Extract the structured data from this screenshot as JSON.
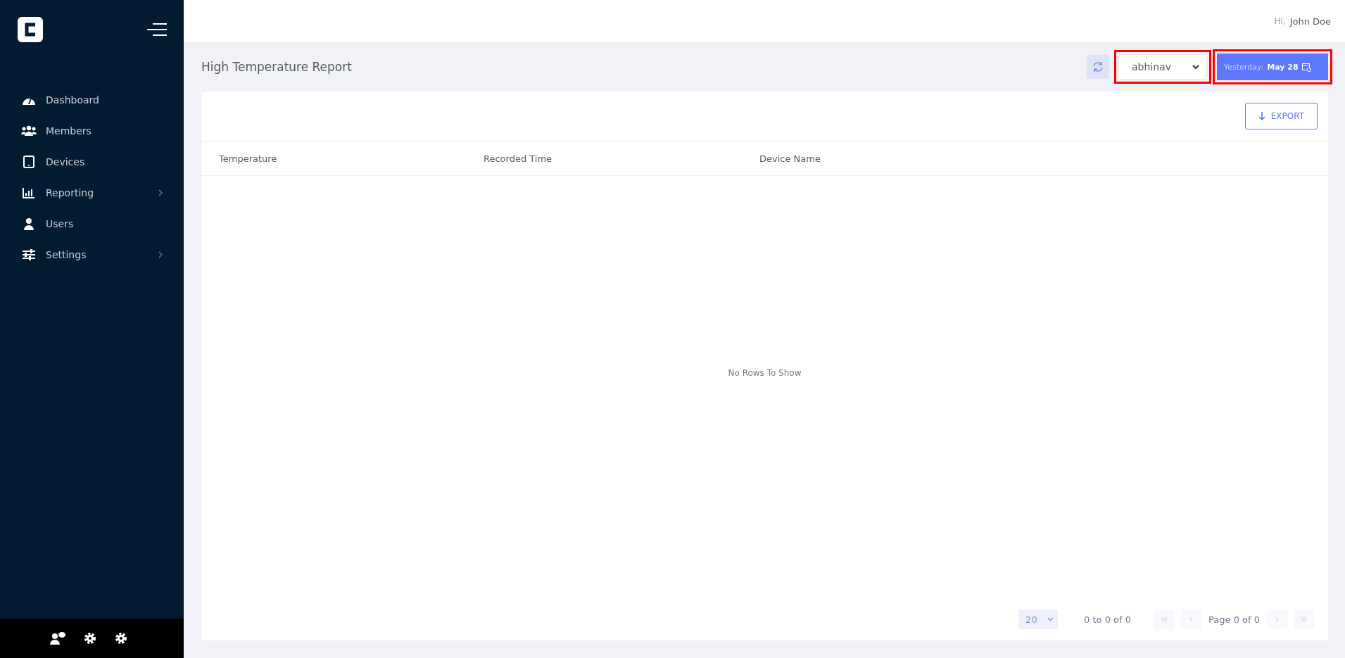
{
  "sidebar": {
    "items": [
      {
        "label": "Dashboard",
        "kind": "gauge",
        "has_submenu": false
      },
      {
        "label": "Members",
        "kind": "group",
        "has_submenu": false
      },
      {
        "label": "Devices",
        "kind": "tablet",
        "has_submenu": false
      },
      {
        "label": "Reporting",
        "kind": "chart",
        "has_submenu": true
      },
      {
        "label": "Users",
        "kind": "user",
        "has_submenu": false
      },
      {
        "label": "Settings",
        "kind": "sliders",
        "has_submenu": true
      }
    ]
  },
  "header": {
    "greeting": "Hi,",
    "user_name": "John Doe"
  },
  "page": {
    "title": "High Temperature Report",
    "member_select": {
      "value": "abhinav",
      "highlighted": true
    },
    "date_button": {
      "label": "Yesterday:",
      "value": "May 28",
      "highlighted": true
    },
    "export_button": "EXPORT"
  },
  "table": {
    "columns": [
      "Temperature",
      "Recorded Time",
      "Device Name"
    ],
    "empty_message": "No Rows To Show"
  },
  "pagination": {
    "page_size": "20",
    "summary": "0 to 0 of 0",
    "page_label": "Page 0 of 0"
  }
}
